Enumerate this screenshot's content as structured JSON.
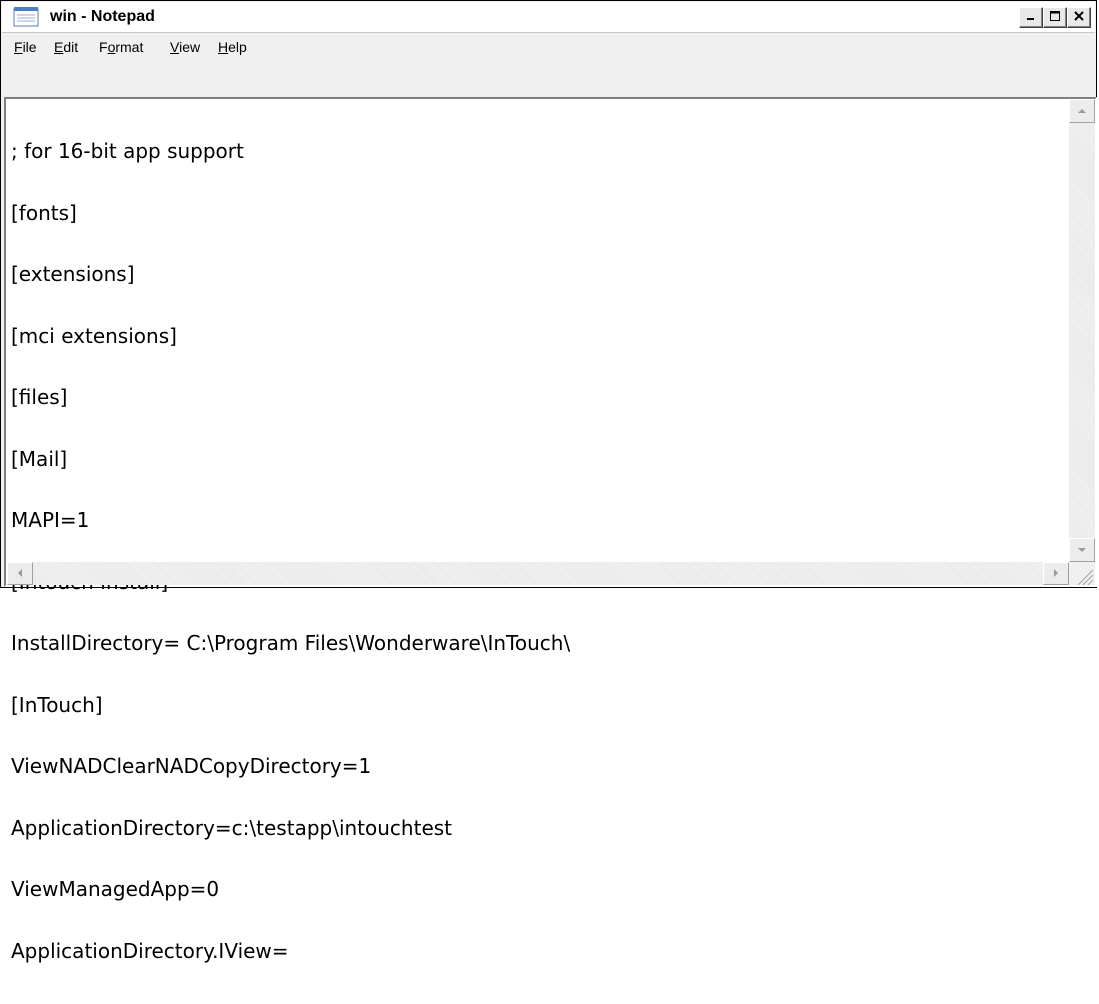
{
  "window": {
    "title": "win - Notepad",
    "menu": [
      {
        "accel": "F",
        "rest": "ile"
      },
      {
        "accel": "E",
        "rest": "dit"
      },
      {
        "pre": "F",
        "accel": "o",
        "rest": "rmat"
      },
      {
        "accel": "V",
        "rest": "iew"
      },
      {
        "accel": "H",
        "rest": "elp"
      }
    ]
  },
  "editor": {
    "lines": [
      "; for 16-bit app support",
      "[fonts]",
      "[extensions]",
      "[mci extensions]",
      "[files]",
      "[Mail]",
      "MAPI=1",
      "[Intouch Install]",
      "InstallDirectory= C:\\Program Files\\Wonderware\\InTouch\\",
      "[InTouch]",
      "ViewNADClearNADCopyDirectory=1",
      "ApplicationDirectory=c:\\testapp\\intouchtest",
      "ViewManagedApp=0",
      "ApplicationDirectory.IView="
    ]
  },
  "icons": {
    "app": "notepad-icon",
    "minimize": "minimize-icon",
    "maximize": "maximize-icon",
    "close": "close-icon",
    "scroll_up": "arrow-up-icon",
    "scroll_down": "arrow-down-icon",
    "scroll_left": "arrow-left-icon",
    "scroll_right": "arrow-right-icon",
    "grip": "resize-grip-icon"
  },
  "colors": {
    "title_icon_blue": "#4a7fc6",
    "window_bg": "#f0f0f0",
    "editor_bg": "#ffffff"
  }
}
